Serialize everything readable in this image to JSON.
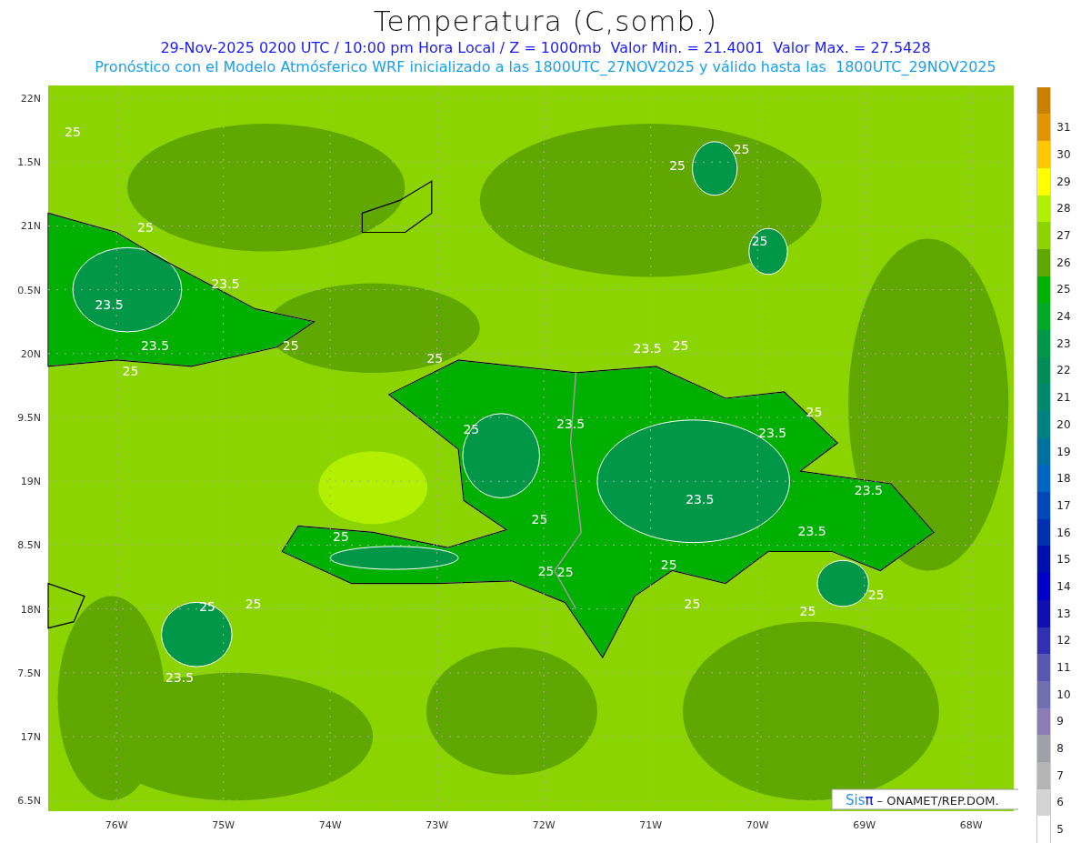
{
  "title": "Temperatura (C,somb.)",
  "subtitle": "29-Nov-2025 0200 UTC / 10:00 pm Hora Local / Z = 1000mb  Valor Min. = 21.4001  Valor Max. = 27.5428",
  "forecast_note": "Pronóstico con el Modelo Atmósferico WRF inicializado a las 1800UTC_27NOV2025 y válido hasta las  1800UTC_29NOV2025",
  "map": {
    "y_ticks": [
      "22N",
      "1.5N",
      "21N",
      "0.5N",
      "20N",
      "9.5N",
      "19N",
      "8.5N",
      "18N",
      "7.5N",
      "17N",
      "6.5N"
    ],
    "x_ticks": [
      "76W",
      "75W",
      "74W",
      "73W",
      "72W",
      "71W",
      "70W",
      "69W",
      "68W"
    ],
    "contour_labels": [
      "25",
      "25",
      "23.5",
      "23.5",
      "23.5",
      "25",
      "25",
      "25",
      "25",
      "23.5",
      "25",
      "25",
      "25",
      "23.5",
      "25",
      "25",
      "23.5",
      "23.5",
      "23.5",
      "23.5",
      "25",
      "25",
      "25",
      "25",
      "25",
      "25",
      "25",
      "25",
      "25",
      "25",
      "23.5"
    ],
    "credit": {
      "brand": "Sis",
      "symbol": "π",
      "text": "– ONAMET/REP.DOM."
    }
  },
  "colorbar": [
    {
      "color": "#c88000"
    },
    {
      "label": "31",
      "color": "#e09600"
    },
    {
      "label": "30",
      "color": "#ffc800"
    },
    {
      "label": "29",
      "color": "#ffff00"
    },
    {
      "label": "28",
      "color": "#b0f000"
    },
    {
      "label": "27",
      "color": "#8cd400"
    },
    {
      "label": "26",
      "color": "#60a800"
    },
    {
      "label": "25",
      "color": "#00b000"
    },
    {
      "label": "24",
      "color": "#00a828"
    },
    {
      "label": "23",
      "color": "#009848"
    },
    {
      "label": "22",
      "color": "#008c58"
    },
    {
      "label": "21",
      "color": "#00886c"
    },
    {
      "label": "20",
      "color": "#008080"
    },
    {
      "label": "19",
      "color": "#00709c"
    },
    {
      "label": "18",
      "color": "#0064c0"
    },
    {
      "label": "17",
      "color": "#0048b8"
    },
    {
      "label": "16",
      "color": "#0030b0"
    },
    {
      "label": "15",
      "color": "#0010b0"
    },
    {
      "label": "14",
      "color": "#0000c8"
    },
    {
      "label": "13",
      "color": "#1010b0"
    },
    {
      "label": "12",
      "color": "#3030b0"
    },
    {
      "label": "11",
      "color": "#5858b0"
    },
    {
      "label": "10",
      "color": "#7070b0"
    },
    {
      "label": "9",
      "color": "#8c7cb4"
    },
    {
      "label": "8",
      "color": "#a0a0a8"
    },
    {
      "label": "7",
      "color": "#b4b4b4"
    },
    {
      "label": "6",
      "color": "#d4d4d4"
    },
    {
      "label": "5",
      "color": "#ffffff"
    }
  ]
}
